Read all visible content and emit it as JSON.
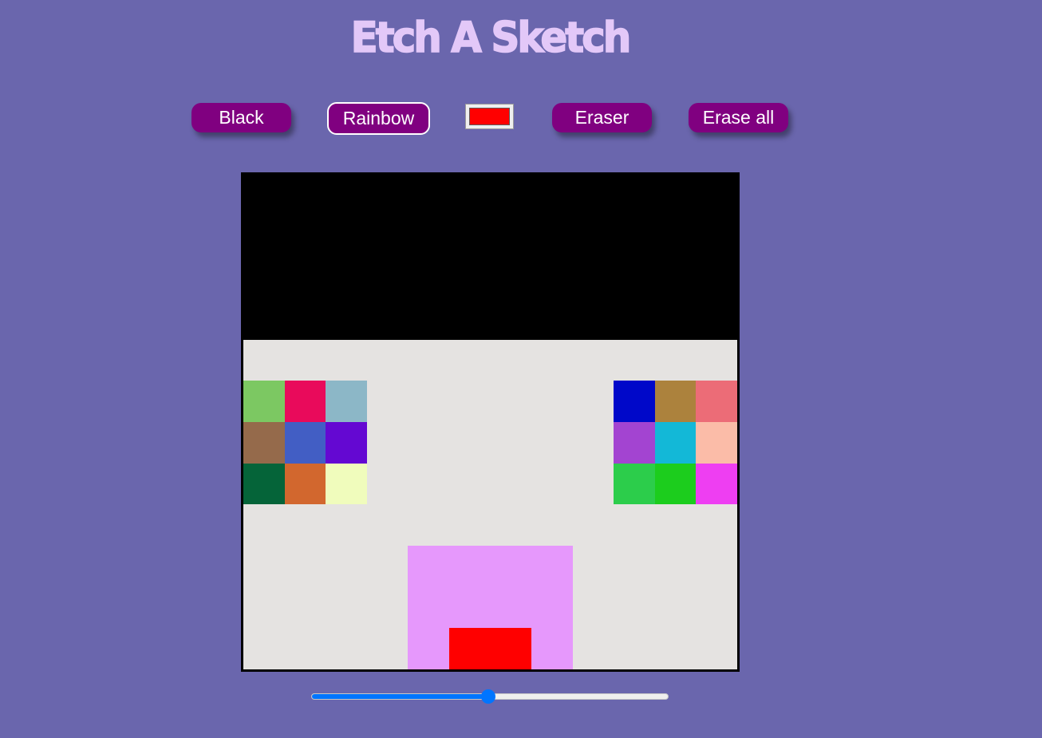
{
  "header": {
    "title": "Etch A Sketch"
  },
  "toolbar": {
    "black_label": "Black",
    "rainbow_label": "Rainbow",
    "eraser_label": "Eraser",
    "erase_all_label": "Erase all",
    "active_mode": "rainbow",
    "picked_color": "#ff0000"
  },
  "colors": {
    "background": "#6a66ad",
    "button": "#800080",
    "grid_background": "#e5e3e1",
    "title": "#e3c8f8",
    "slider_accent": "#0075ff"
  },
  "grid": {
    "size": 12,
    "cells": [
      [
        "#000000",
        "#000000",
        "#000000",
        "#000000",
        "#000000",
        "#000000",
        "#000000",
        "#000000",
        "#000000",
        "#000000",
        "#000000",
        "#000000"
      ],
      [
        "#000000",
        "#000000",
        "#000000",
        "#000000",
        "#000000",
        "#000000",
        "#000000",
        "#000000",
        "#000000",
        "#000000",
        "#000000",
        "#000000"
      ],
      [
        "#000000",
        "#000000",
        "#000000",
        "#000000",
        "#000000",
        "#000000",
        "#000000",
        "#000000",
        "#000000",
        "#000000",
        "#000000",
        "#000000"
      ],
      [
        "#000000",
        "#000000",
        "#000000",
        "#000000",
        "#000000",
        "#000000",
        "#000000",
        "#000000",
        "#000000",
        "#000000",
        "#000000",
        "#000000"
      ],
      [
        "",
        "",
        "",
        "",
        "",
        "",
        "",
        "",
        "",
        "",
        "",
        ""
      ],
      [
        "#7cc862",
        "#e90a5b",
        "#8cb7c7",
        "",
        "",
        "",
        "",
        "",
        "",
        "#0008c9",
        "#ac823d",
        "#ec6c77"
      ],
      [
        "#956a4b",
        "#425ec4",
        "#6408d2",
        "",
        "",
        "",
        "",
        "",
        "",
        "#a344d1",
        "#13b8d7",
        "#fbbca8"
      ],
      [
        "#056439",
        "#d2672e",
        "#f0fcbc",
        "",
        "",
        "",
        "",
        "",
        "",
        "#2ccd4b",
        "#1ccd1d",
        "#ee3ef2"
      ],
      [
        "",
        "",
        "",
        "",
        "",
        "",
        "",
        "",
        "",
        "",
        "",
        ""
      ],
      [
        "",
        "",
        "",
        "",
        "#e698fc",
        "#e698fc",
        "#e698fc",
        "#e698fc",
        "",
        "",
        "",
        ""
      ],
      [
        "",
        "",
        "",
        "",
        "#e698fc",
        "#e698fc",
        "#e698fc",
        "#e698fc",
        "",
        "",
        "",
        ""
      ],
      [
        "",
        "",
        "",
        "",
        "#e698fc",
        "#ff0000",
        "#ff0000",
        "#e698fc",
        "",
        "",
        "",
        ""
      ]
    ]
  },
  "slider": {
    "min": 1,
    "max": 100,
    "value": 50
  }
}
